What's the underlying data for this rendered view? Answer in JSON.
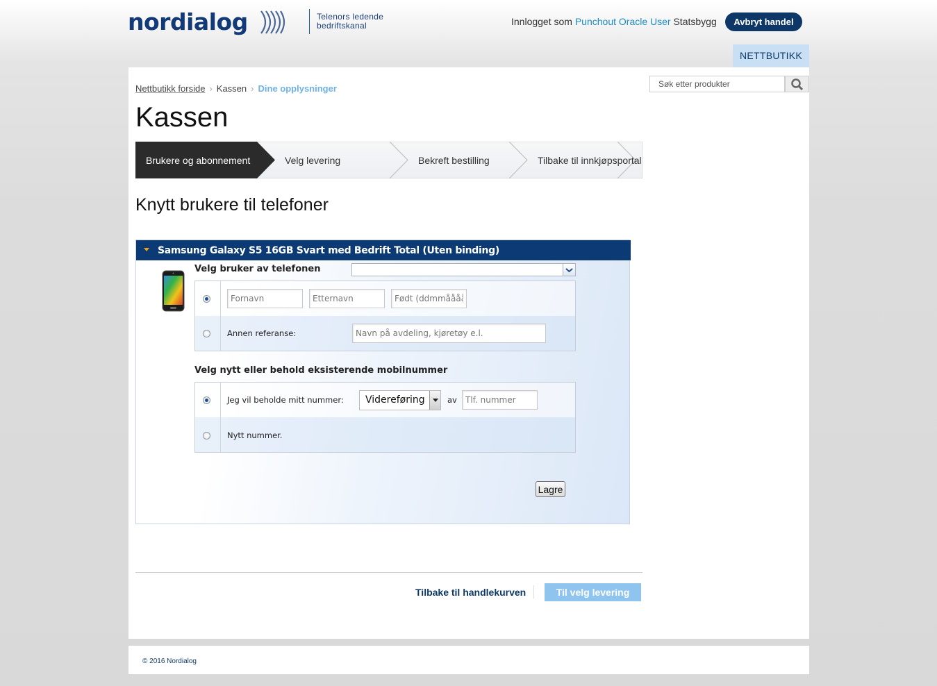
{
  "header": {
    "logo_text": "nordialog",
    "tagline_line1": "Telenors ledende",
    "tagline_line2": "bedriftskanal",
    "login_prefix": "Innlogget som",
    "login_user": "Punchout Oracle User",
    "login_org": "Statsbygg",
    "abort_label": "Avbryt handel",
    "nav_label": "NETTBUTIKK"
  },
  "breadcrumb": {
    "home": "Nettbutikk forside",
    "checkout": "Kassen",
    "current": "Dine opplysninger"
  },
  "search": {
    "placeholder": "Søk etter produkter"
  },
  "page_title": "Kassen",
  "steps": [
    {
      "label": "Brukere og abonnement",
      "active": true
    },
    {
      "label": "Velg levering",
      "active": false
    },
    {
      "label": "Bekreft bestilling",
      "active": false
    },
    {
      "label": "Tilbake til innkjøpsportal",
      "active": false
    }
  ],
  "subtitle": "Knytt brukere til telefoner",
  "product": {
    "title": "Samsung Galaxy S5 16GB Svart med Bedrift Total (Uten binding)",
    "choose_user_label": "Velg bruker av telefonen",
    "first_name_placeholder": "Fornavn",
    "last_name_placeholder": "Etternavn",
    "birth_placeholder": "Født (ddmmåååå)",
    "other_ref_label": "Annen referanse:",
    "other_ref_placeholder": "Navn på avdeling, kjøretøy e.l.",
    "number_section_label": "Velg nytt eller behold eksisterende mobilnummer",
    "keep_number_label": "Jeg vil beholde mitt nummer:",
    "forward_option": "Videreføring",
    "av_label": "av",
    "phone_placeholder": "Tlf. nummer",
    "new_number_label": "Nytt nummer.",
    "save_label": "Lagre"
  },
  "actions": {
    "back_label": "Tilbake til handlekurven",
    "next_label": "Til velg levering"
  },
  "footer": {
    "copyright": "© 2016 Nordialog"
  },
  "colors": {
    "brand_navy": "#0d3766",
    "panel_header": "#0b3a74",
    "link_blue": "#1a8cc4",
    "breadcrumb_current": "#6fb2e6",
    "next_button": "#8fc4ee",
    "nav_tab": "#c9e0f4",
    "active_step": "#2b2b2b"
  },
  "icons": {
    "search": "search-icon",
    "logo_waves": "signal-waves-icon",
    "panel_toggle": "triangle-down-icon",
    "dropdown": "chevron-down-icon",
    "phone": "phone-product-image"
  }
}
